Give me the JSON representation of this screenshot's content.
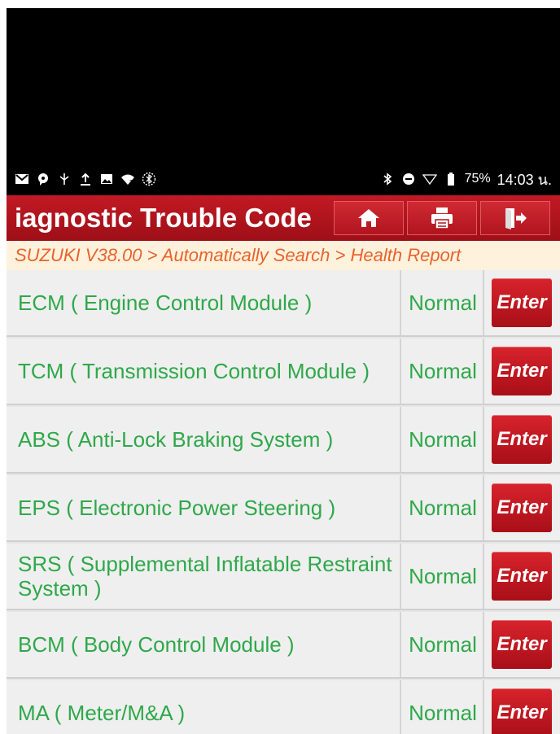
{
  "status_bar": {
    "left_icons": [
      "gmail-icon",
      "chat-icon",
      "usb-icon",
      "upload-icon",
      "image-icon",
      "wifi-question-icon",
      "bluetooth-circle-icon"
    ],
    "right_icons": [
      "bluetooth-icon",
      "dnd-icon",
      "signal-icon",
      "battery-icon"
    ],
    "battery": "75%",
    "time": "14:03 น."
  },
  "header": {
    "title": "iagnostic Trouble Code",
    "buttons": [
      "home-icon",
      "print-icon",
      "exit-icon"
    ]
  },
  "breadcrumb": "SUZUKI V38.00 > Automatically Search > Health Report",
  "rows": [
    {
      "name": "ECM ( Engine Control Module )",
      "status": "Normal",
      "action": "Enter"
    },
    {
      "name": "TCM ( Transmission Control Module )",
      "status": "Normal",
      "action": "Enter"
    },
    {
      "name": "ABS ( Anti-Lock Braking System )",
      "status": "Normal",
      "action": "Enter"
    },
    {
      "name": "EPS ( Electronic Power Steering )",
      "status": "Normal",
      "action": "Enter"
    },
    {
      "name": "SRS ( Supplemental Inflatable Restraint System )",
      "status": "Normal",
      "action": "Enter"
    },
    {
      "name": "BCM ( Body Control Module )",
      "status": "Normal",
      "action": "Enter"
    },
    {
      "name": "MA ( Meter/M&A )",
      "status": "Normal",
      "action": "Enter"
    }
  ],
  "colors": {
    "accent_red": "#b5121b",
    "status_green": "#2fa84a",
    "breadcrumb_orange": "#e8632b",
    "breadcrumb_bg": "#fff2dd"
  }
}
